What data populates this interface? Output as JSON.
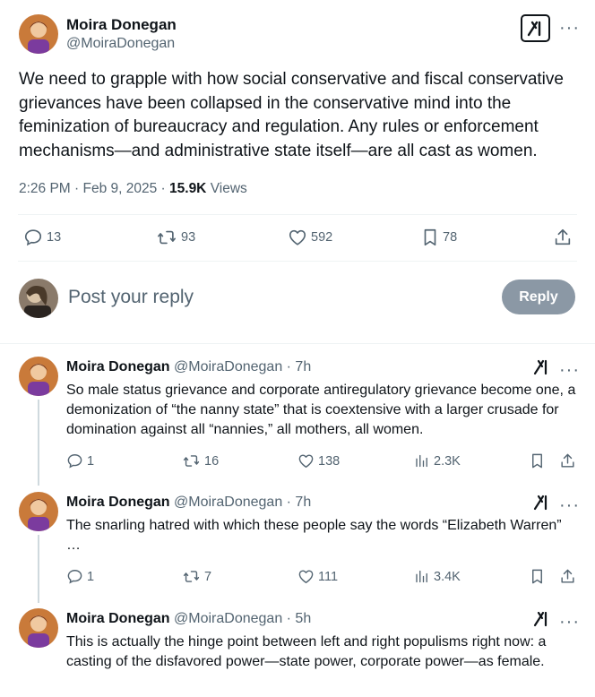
{
  "tweet": {
    "author_name": "Moira Donegan",
    "author_handle": "@MoiraDonegan",
    "text": "We need to grapple with how social conservative and fiscal conservative grievances have been collapsed in the conservative mind into the feminization of bureaucracy and regulation. Any rules or enforcement mechanisms—and  administrative state itself—are all cast as women.",
    "time": "2:26 PM · Feb 9, 2025 · ",
    "views_count": "15.9K",
    "views_label": " Views",
    "replies": "13",
    "reposts": "93",
    "likes": "592",
    "bookmarks": "78"
  },
  "composer": {
    "placeholder": "Post your reply",
    "button_label": "Reply"
  },
  "replies": [
    {
      "name": "Moira Donegan",
      "handle": "@MoiraDonegan · 7h",
      "text": "So male status grievance and corporate antiregulatory grievance become one, a demonization of “the nanny state” that is coextensive with a larger crusade for domination against all “nannies,” all mothers, all women.",
      "replies": "1",
      "reposts": "16",
      "likes": "138",
      "views": "2.3K"
    },
    {
      "name": "Moira Donegan",
      "handle": "@MoiraDonegan · 7h",
      "text": "The snarling hatred with which these people say the words “Elizabeth Warren” …",
      "replies": "1",
      "reposts": "7",
      "likes": "111",
      "views": "3.4K"
    },
    {
      "name": "Moira Donegan",
      "handle": "@MoiraDonegan · 5h",
      "text": "This is actually the hinge point between left and right populisms right now: a casting of the disfavored power—state power, corporate power—as female."
    }
  ],
  "icons": {
    "grok": "grok-icon",
    "more": "more-icon",
    "reply": "reply-icon",
    "repost": "repost-icon",
    "like": "like-icon",
    "bookmark": "bookmark-icon",
    "share": "share-icon",
    "views": "views-icon"
  },
  "colors": {
    "text": "#0f1419",
    "secondary": "#536471",
    "reply_button": "#8b98a5",
    "divider": "#eff3f4"
  }
}
